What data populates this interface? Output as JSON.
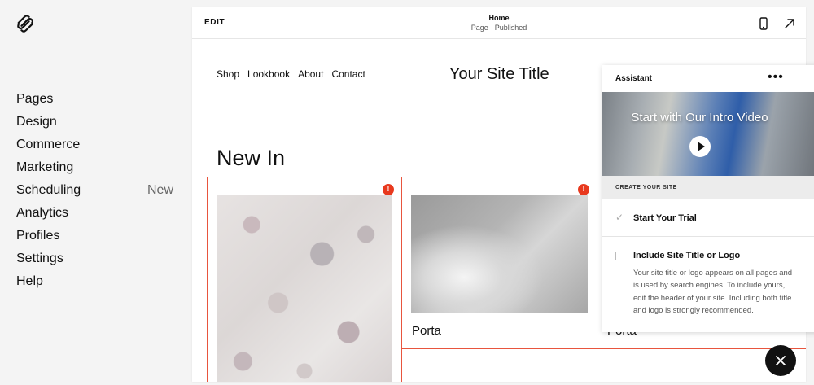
{
  "sidebar": {
    "items": [
      {
        "label": "Pages",
        "badge": ""
      },
      {
        "label": "Design",
        "badge": ""
      },
      {
        "label": "Commerce",
        "badge": ""
      },
      {
        "label": "Marketing",
        "badge": ""
      },
      {
        "label": "Scheduling",
        "badge": "New"
      },
      {
        "label": "Analytics",
        "badge": ""
      },
      {
        "label": "Profiles",
        "badge": ""
      },
      {
        "label": "Settings",
        "badge": ""
      },
      {
        "label": "Help",
        "badge": ""
      }
    ]
  },
  "topbar": {
    "edit_label": "EDIT",
    "page_name": "Home",
    "page_status": "Page · Published"
  },
  "site": {
    "nav": [
      "Shop",
      "Lookbook",
      "About",
      "Contact"
    ],
    "title": "Your Site Title",
    "section_title": "New In",
    "products": [
      {
        "name": "",
        "warning": "!"
      },
      {
        "name": "Porta",
        "warning": "!"
      },
      {
        "name": "Porta",
        "warning": ""
      }
    ]
  },
  "assistant": {
    "title": "Assistant",
    "more": "•••",
    "video_title": "Start with Our Intro Video",
    "section_label": "CREATE YOUR SITE",
    "tasks": [
      {
        "title": "Start Your Trial",
        "done": true,
        "description": ""
      },
      {
        "title": "Include Site Title or Logo",
        "done": false,
        "description": "Your site title or logo appears on all pages and is used by search engines. To include yours, edit the header of your site. Including both title and logo is strongly recommended."
      }
    ]
  },
  "colors": {
    "accent_border": "#e8553e",
    "warning_badge": "#e8391e"
  }
}
